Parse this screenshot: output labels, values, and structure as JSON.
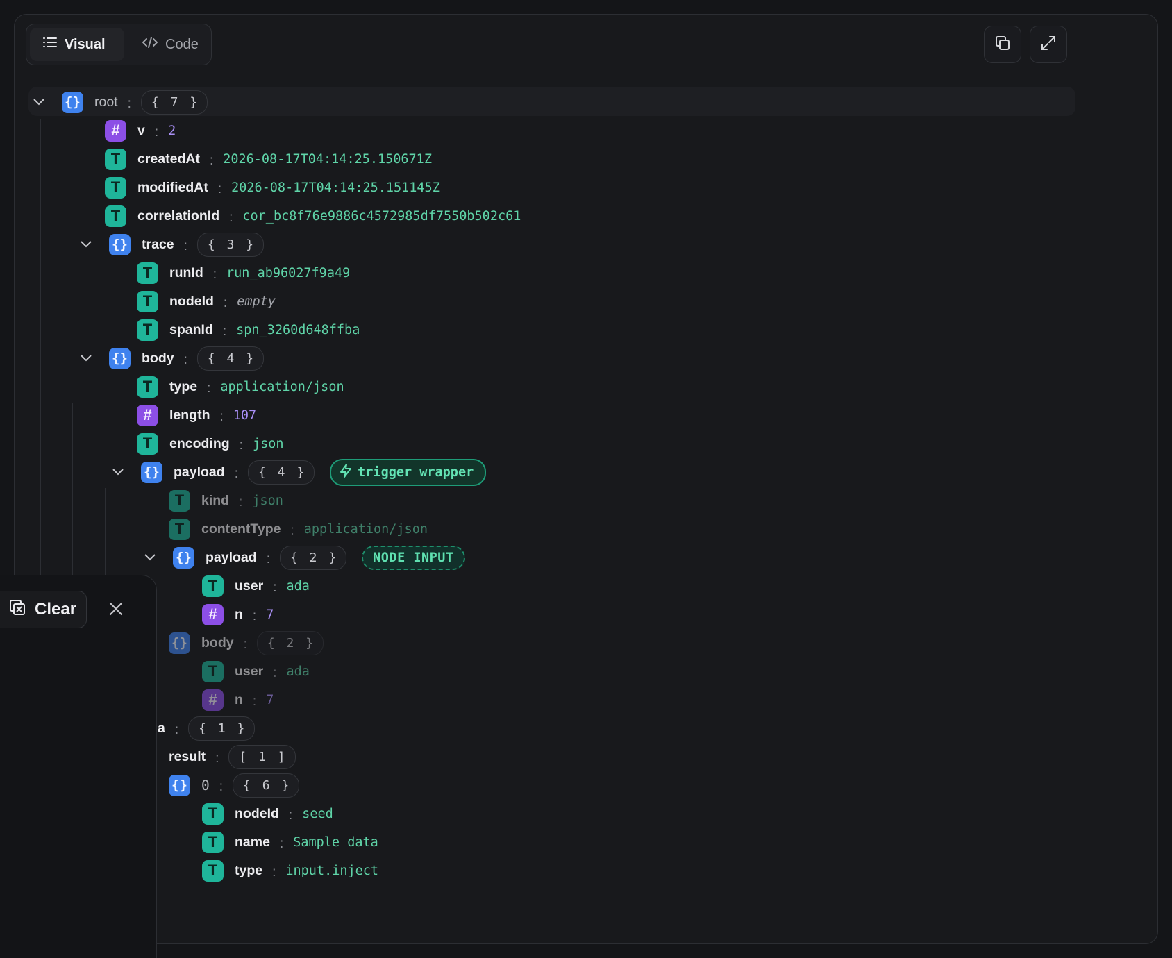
{
  "toolbar": {
    "tabs": [
      {
        "label": "Visual",
        "icon": "list-icon"
      },
      {
        "label": "Code",
        "icon": "code-icon"
      }
    ],
    "copy_icon": "copy-icon",
    "expand_icon": "expand-icon"
  },
  "tree": {
    "root": {
      "key": "root",
      "count": "{ 7 }"
    },
    "v": {
      "key": "v",
      "value": "2"
    },
    "createdAt": {
      "key": "createdAt",
      "value": "2026-08-17T04:14:25.150671Z"
    },
    "modifiedAt": {
      "key": "modifiedAt",
      "value": "2026-08-17T04:14:25.151145Z"
    },
    "correlationId": {
      "key": "correlationId",
      "value": "cor_bc8f76e9886c4572985df7550b502c61"
    },
    "trace": {
      "key": "trace",
      "count": "{ 3 }"
    },
    "runId": {
      "key": "runId",
      "value": "run_ab96027f9a49"
    },
    "nodeId": {
      "key": "nodeId",
      "value": "empty"
    },
    "spanId": {
      "key": "spanId",
      "value": "spn_3260d648ffba"
    },
    "body": {
      "key": "body",
      "count": "{ 4 }"
    },
    "body_type": {
      "key": "type",
      "value": "application/json"
    },
    "length": {
      "key": "length",
      "value": "107"
    },
    "encoding": {
      "key": "encoding",
      "value": "json"
    },
    "payload": {
      "key": "payload",
      "count": "{ 4 }",
      "badge": "trigger wrapper"
    },
    "kind": {
      "key": "kind",
      "value": "json"
    },
    "contentType": {
      "key": "contentType",
      "value": "application/json"
    },
    "payload_inner": {
      "key": "payload",
      "count": "{ 2 }",
      "badge": "NODE INPUT"
    },
    "user1": {
      "key": "user",
      "value": "ada"
    },
    "n1": {
      "key": "n",
      "value": "7"
    },
    "body_inner": {
      "key": "body",
      "count": "{ 2 }"
    },
    "user2": {
      "key": "user",
      "value": "ada"
    },
    "n2": {
      "key": "n",
      "value": "7"
    },
    "a_obj": {
      "key": "a",
      "count": "{ 1 }"
    },
    "result": {
      "key": "result",
      "count": "[ 1 ]"
    },
    "item0": {
      "key": "0",
      "count": "{ 6 }"
    },
    "nodeId2": {
      "key": "nodeId",
      "value": "seed"
    },
    "name": {
      "key": "name",
      "value": "Sample data"
    },
    "type2": {
      "key": "type",
      "value": "input.inject"
    }
  },
  "icons": {
    "string": "T",
    "number": "#",
    "object": "{}"
  },
  "overlay": {
    "clear_label": "Clear",
    "close_icon": "close-icon"
  }
}
